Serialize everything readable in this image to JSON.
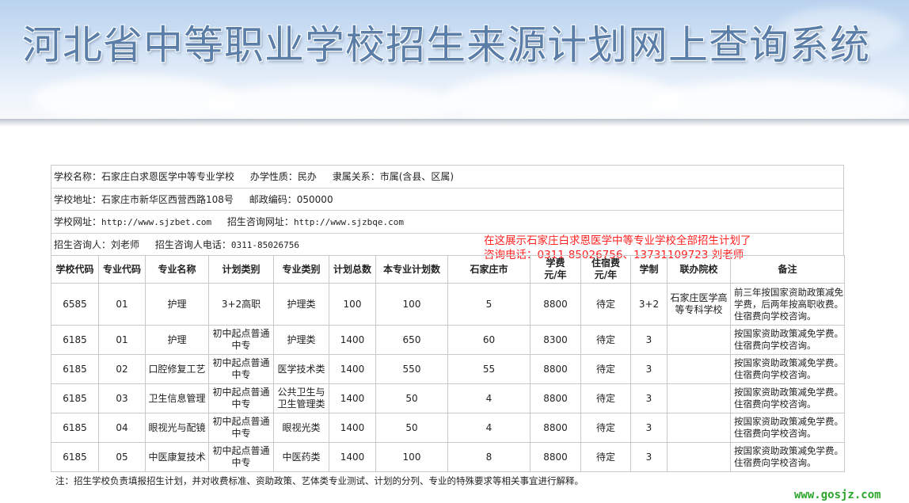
{
  "header": {
    "title": "河北省中等职业学校招生来源计划网上查询系统"
  },
  "school_info": {
    "name_label": "学校名称：",
    "name": "石家庄白求恩医学中等专业学校",
    "nature_label": "办学性质：",
    "nature": "民办",
    "affiliation_label": "隶属关系：",
    "affiliation": "市属(含县、区属)",
    "address_label": "学校地址：",
    "address": "石家庄市新华区西营西路108号",
    "postcode_label": "邮政编码：",
    "postcode": "050000",
    "website_label": "学校网址：",
    "website": "http://www.sjzbet.com",
    "consult_site_label": "招生咨询网址：",
    "consult_site": "http://www.sjzbqe.com",
    "contact_label": "招生咨询人：",
    "contact": "刘老师",
    "phone_label": "招生咨询人电话：",
    "phone": "0311-85026756"
  },
  "notice": {
    "line1": "在这展示石家庄白求恩医学中等专业学校全部招生计划了",
    "line2": "咨询电话：0311-85026756、13731109723 刘老师"
  },
  "table": {
    "headers": [
      "学校代码",
      "专业代码",
      "专业名称",
      "计划类别",
      "专业类别",
      "计划总数",
      "本专业计划数",
      "石家庄市",
      "学费\n元/年",
      "住宿费\n元/年",
      "学制",
      "联办院校",
      "备注"
    ],
    "rows": [
      [
        "6585",
        "01",
        "护理",
        "3+2高职",
        "护理类",
        "100",
        "100",
        "5",
        "8800",
        "待定",
        "3+2",
        "石家庄医学高等专科学校",
        "前三年按国家资助政策减免学费，后两年按高职收费。住宿费向学校咨询。"
      ],
      [
        "6185",
        "01",
        "护理",
        "初中起点普通中专",
        "护理类",
        "1400",
        "650",
        "60",
        "8300",
        "待定",
        "3",
        "",
        "按国家资助政策减免学费。住宿费向学校咨询。"
      ],
      [
        "6185",
        "02",
        "口腔修复工艺",
        "初中起点普通中专",
        "医学技术类",
        "1400",
        "550",
        "55",
        "8800",
        "待定",
        "3",
        "",
        "按国家资助政策减免学费。住宿费向学校咨询。"
      ],
      [
        "6185",
        "03",
        "卫生信息管理",
        "初中起点普通中专",
        "公共卫生与卫生管理类",
        "1400",
        "50",
        "4",
        "8800",
        "待定",
        "3",
        "",
        "按国家资助政策减免学费。住宿费向学校咨询。"
      ],
      [
        "6185",
        "04",
        "眼视光与配镜",
        "初中起点普通中专",
        "眼视光类",
        "1400",
        "50",
        "4",
        "8800",
        "待定",
        "3",
        "",
        "按国家资助政策减免学费。住宿费向学校咨询。"
      ],
      [
        "6185",
        "05",
        "中医康复技术",
        "初中起点普通中专",
        "中医药类",
        "1400",
        "100",
        "8",
        "8800",
        "待定",
        "3",
        "",
        "按国家资助政策减免学费。住宿费向学校咨询。"
      ]
    ]
  },
  "footnote": "注：招生学校负责填报招生计划，并对收费标准、资助政策、艺体类专业测试、计划的分列、专业的特殊要求等相关事宜进行解释。",
  "watermark": "www.gosjz.com",
  "colors": {
    "title": "#5b7ea8",
    "notice": "#ff2020",
    "watermark": "#2aa52a",
    "border": "#c9c9c9"
  }
}
